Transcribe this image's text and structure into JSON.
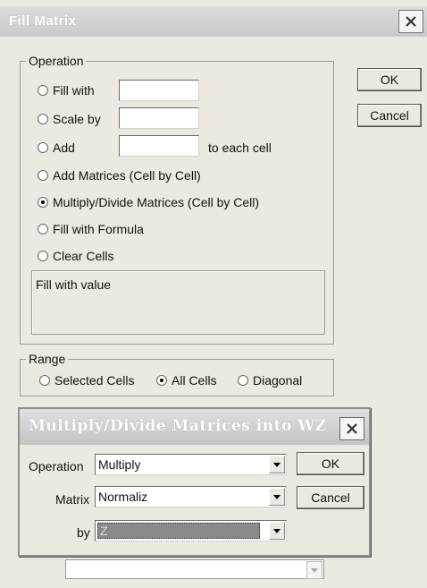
{
  "main_dialog": {
    "title": "Fill Matrix",
    "close_icon": "close-icon",
    "operation_group": {
      "legend": "Operation",
      "options": [
        {
          "label": "Fill with",
          "checked": false
        },
        {
          "label": "Scale by",
          "checked": false
        },
        {
          "label": "Add",
          "checked": false
        },
        {
          "label": "Add Matrices (Cell by Cell)",
          "checked": false
        },
        {
          "label": "Multiply/Divide Matrices (Cell by Cell)",
          "checked": true
        },
        {
          "label": "Fill with Formula",
          "checked": false
        },
        {
          "label": "Clear Cells",
          "checked": false
        }
      ],
      "fill_with_value": "",
      "scale_by_value": "",
      "add_value": "",
      "add_suffix": "to each cell",
      "description": "Fill with value"
    },
    "buttons": {
      "ok": "OK",
      "cancel": "Cancel"
    },
    "range_group": {
      "legend": "Range",
      "options": [
        {
          "label": "Selected Cells",
          "checked": false
        },
        {
          "label": "All Cells",
          "checked": true
        },
        {
          "label": "Diagonal",
          "checked": false
        }
      ]
    }
  },
  "sub_dialog": {
    "title": "Multiply/Divide Matrices into WZ",
    "close_icon": "close-icon",
    "operation_label": "Operation",
    "operation_value": "Multiply",
    "matrix_label": "Matrix",
    "matrix_value": "Normaliz",
    "by_label": "by",
    "by_value": "Z",
    "ok": "OK",
    "cancel": "Cancel"
  }
}
